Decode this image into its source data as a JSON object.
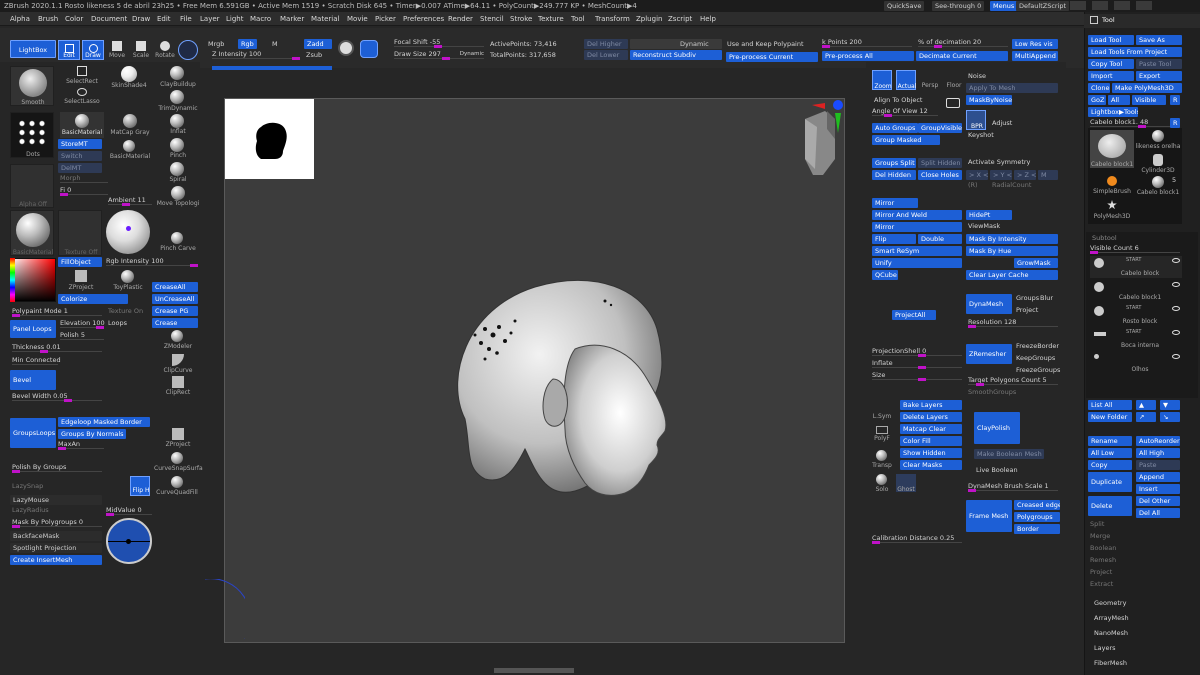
{
  "titlebar": {
    "text": "ZBrush 2020.1.1  Rosto likeness 5 de abril 23h25 • Free Mem 6.591GB • Active Mem 1519 • Scratch Disk 645 • Timer▶0.007 ATime▶64.11 • PolyCount▶249.777 KP • MeshCount▶4"
  },
  "topright": {
    "quicksave": "QuickSave",
    "seethrough": "See-through  0",
    "menus": "Menus",
    "script": "DefaultZScript"
  },
  "menus": [
    "Alpha",
    "Brush",
    "Color",
    "Document",
    "Draw",
    "Edit",
    "File",
    "Layer",
    "Light",
    "Macro",
    "Marker",
    "Material",
    "Movie",
    "Picker",
    "Preferences",
    "Render",
    "Stencil",
    "Stroke",
    "Texture",
    "Transform",
    "Zplugin",
    "Zscript",
    "Help"
  ],
  "toolbar": {
    "lightbox": "LightBox",
    "edit": "Edit",
    "draw": "Draw",
    "move": "Move",
    "scale": "Scale",
    "rotate": "Rotate",
    "mrgb": "Mrgb",
    "rgb": "Rgb",
    "m": "M",
    "zadd": "Zadd",
    "zsub": "Zsub",
    "z_intensity": "Z Intensity 100",
    "focal_shift": "Focal Shift -55",
    "draw_size": "Draw Size 297",
    "dynamic_small": "Dynamic",
    "active_points": "ActivePoints: 73,416",
    "total_points": "TotalPoints: 317,658",
    "del_higher": "Del Higher",
    "del_lower": "Del Lower",
    "dynamic": "Dynamic",
    "reconstruct": "Reconstruct Subdiv",
    "keep_polypaint": "Use and Keep Polypaint",
    "preprocess_current": "Pre-process Current",
    "k_points": "k Points 200",
    "preprocess_all": "Pre-process All",
    "pct_decimation": "% of decimation 20",
    "decimate_current": "Decimate Current",
    "low_res": "Low Res vis",
    "multiappend": "MultiAppend"
  },
  "left": {
    "brushes": [
      "Smooth",
      "SelectRect",
      "SkinShade4",
      "ClayBuildup",
      "SelectLasso",
      "TrimDynamic",
      "Dots",
      "BasicMaterial",
      "MatCap Gray",
      "Inflat",
      "Pinch",
      "Alpha Off",
      "Spiral",
      "Move Topologi",
      "BasicMaterial",
      "Texture Off",
      "Pinch Carve"
    ],
    "storemt": "StoreMT",
    "switch": "Switch",
    "delmt": "DelMT",
    "morph": "Morph",
    "fill_label": "Fi 0",
    "ambient": "Ambient 11",
    "fillobject": "FillObject",
    "rgb_intensity": "Rgb Intensity 100",
    "colorize": "Colorize",
    "zproject": "ZProject",
    "toyplastic": "ToyPlastic",
    "creaseall": "CreaseAll",
    "uncreaseall": "UnCreaseAll",
    "crease_pg": "Crease PG",
    "crease": "Crease",
    "polypaint_mode": "Polypaint Mode 1",
    "texture_on": "Texture On",
    "panel_loops": "Panel Loops",
    "elevation": "Elevation 100",
    "loops": "Loops",
    "polish": "Polish 5",
    "thickness": "Thickness 0.01",
    "min_connected": "Min Connected",
    "bevel": "Bevel",
    "bevel_width": "Bevel Width 0.05",
    "zmodeler": "ZModeler",
    "clipcurve": "ClipCurve",
    "cliprect": "ClipRect",
    "groupsloops": "GroupsLoops",
    "edgeloop": "Edgeloop Masked Border",
    "groups_by_normals": "Groups By Normals",
    "maxan": "MaxAn",
    "polish_by_groups": "Polish By Groups",
    "lazysnap": "LazySnap",
    "lazymouse": "LazyMouse",
    "lazyradius": "LazyRadius",
    "mask_by_polygroups": "Mask By Polygroups 0",
    "backfacemask": "BackfaceMask",
    "spotlight": "Spotlight Projection",
    "create_insertmesh": "Create InsertMesh",
    "zproject2": "ZProject",
    "curvesnap": "CurveSnapSurfa",
    "curvequad": "CurveQuadFill",
    "fliph": "Flip H",
    "midvalue": "MidValue 0"
  },
  "right_col1": {
    "zoom": "Zoom",
    "actual": "Actual",
    "persp": "Persp",
    "floor": "Floor",
    "noise": "Noise",
    "apply_to_mesh": "Apply To Mesh",
    "align_to_object": "Align To Object",
    "angle_of_view": "Angle Of View 12",
    "maskbynoise": "MaskByNoise",
    "auto_groups": "Auto Groups",
    "groupvisible": "GroupVisible",
    "bpr": "BPR",
    "adjust": "Adjust",
    "group_masked": "Group Masked",
    "keyshot": "Keyshot",
    "groups_split": "Groups Split",
    "split_hidden": "Split Hidden",
    "activate_symmetry": "Activate Symmetry",
    "del_hidden": "Del Hidden",
    "close_holes": "Close Holes",
    "sym_x": "> X <",
    "sym_y": "> Y <",
    "sym_z": "> Z <",
    "sym_m": "M",
    "sym_r": "(R)",
    "radial_count": "RadialCount",
    "mirror": "Mirror",
    "mirror_and_weld": "Mirror And Weld",
    "hidept": "HidePt",
    "mirror2": "Mirror",
    "viewmask": "ViewMask",
    "flip": "Flip",
    "double": "Double",
    "mask_by_intensity": "Mask By Intensity",
    "smart_resym": "Smart ReSym",
    "mask_by_hue": "Mask By Hue",
    "unify": "Unify",
    "growmask": "GrowMask",
    "qcube": "QCube",
    "clear_layer_cache": "Clear Layer Cache",
    "dynamesh": "DynaMesh",
    "groups": "Groups",
    "blur": "Blur",
    "projectall": "ProjectAll",
    "project": "Project",
    "resolution": "Resolution 128",
    "projectionshell": "ProjectionShell 0",
    "inflate": "Inflate",
    "size": "Size",
    "zremesher": "ZRemesher",
    "freezeborder": "FreezeBorder",
    "keepgroups": "KeepGroups",
    "freezegroups": "FreezeGroups",
    "target_polygons": "Target Polygons Count 5",
    "smoothgroups": "SmoothGroups",
    "lsym": "L.Sym",
    "polyf": "PolyF",
    "transp": "Transp",
    "solo": "Solo",
    "ghost": "Ghost",
    "bake_layers": "Bake Layers",
    "delete_layers": "Delete Layers",
    "matcap_clear": "Matcap Clear",
    "color_fill": "Color Fill",
    "show_hidden": "Show Hidden",
    "clear_masks": "Clear Masks",
    "claypolish": "ClayPolish",
    "make_boolean": "Make Boolean Mesh",
    "live_boolean": "Live Boolean",
    "dynamesh_brush_scale": "DynaMesh Brush Scale 1",
    "frame_mesh": "Frame Mesh",
    "creased_edges": "Creased edges",
    "polygroups": "Polygroups",
    "border": "Border",
    "calibration": "Calibration Distance 0.25"
  },
  "tool_panel": {
    "title": "Tool",
    "load_tool": "Load Tool",
    "save_as": "Save As",
    "load_from_project": "Load Tools From Project",
    "copy_tool": "Copy Tool",
    "paste_tool": "Paste Tool",
    "import": "Import",
    "export": "Export",
    "clone": "Clone",
    "make_polymesh": "Make PolyMesh3D",
    "goz": "GoZ",
    "all": "All",
    "visible": "Visible",
    "r": "R",
    "lightbox_tools": "Lightbox▶Tools",
    "current_tool": "Cabelo block1. 48",
    "r2": "R",
    "thumbs": [
      "Cabelo block1",
      "likeness orelha",
      "Cylinder3D",
      "SimpleBrush",
      "Cabelo block1",
      "PolyMesh3D"
    ],
    "thumb_count": "5",
    "subtool_title": "Subtool",
    "visible_count": "Visible Count 6",
    "subtools": [
      "Cabelo block",
      "Cabelo block1",
      "Rosto block",
      "Boca interna",
      "Olhos"
    ],
    "list_all": "List All",
    "new_folder": "New Folder",
    "rename": "Rename",
    "autoreorder": "AutoReorder",
    "all_low": "All Low",
    "all_high": "All High",
    "copy": "Copy",
    "paste": "Paste",
    "duplicate": "Duplicate",
    "append": "Append",
    "insert": "Insert",
    "delete": "Delete",
    "del_other": "Del Other",
    "del_all": "Del All",
    "split": "Split",
    "merge": "Merge",
    "boolean": "Boolean",
    "remesh": "Remesh",
    "project": "Project",
    "extract": "Extract",
    "geometry": "Geometry",
    "arraymesh": "ArrayMesh",
    "nanomesh": "NanoMesh",
    "layers": "Layers",
    "fibermesh": "FiberMesh"
  },
  "colors": {
    "accent": "#1d5fd6",
    "slider": "#c012c8",
    "bg": "#262626",
    "viewport": "#3c3c3c"
  }
}
